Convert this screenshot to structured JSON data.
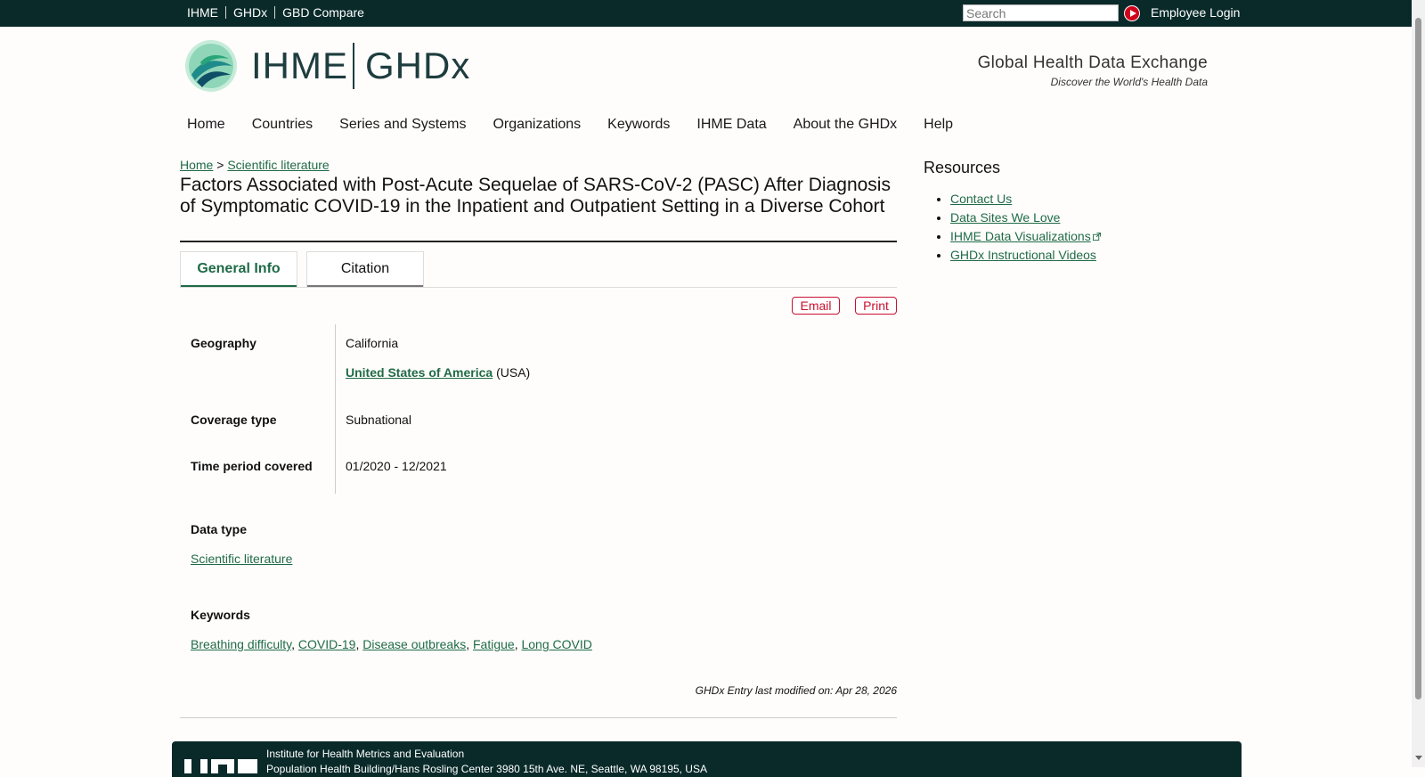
{
  "topbar": {
    "links": [
      "IHME",
      "GHDx",
      "GBD Compare"
    ],
    "search_placeholder": "Search",
    "employee_login": "Employee Login"
  },
  "header": {
    "logo_left": "IHME",
    "logo_right": "GHDx",
    "tagline": "Global Health Data Exchange",
    "subtagline": "Discover the World's Health Data"
  },
  "nav": [
    "Home",
    "Countries",
    "Series and Systems",
    "Organizations",
    "Keywords",
    "IHME Data",
    "About the GHDx",
    "Help"
  ],
  "breadcrumb": {
    "home": "Home",
    "sep": ">",
    "current": "Scientific literature"
  },
  "page": {
    "title": "Factors Associated with Post-Acute Sequelae of SARS-CoV-2 (PASC) After Diagnosis of Symptomatic COVID-19 in the Inpatient and Outpatient Setting in a Diverse Cohort"
  },
  "tabs": [
    "General Info",
    "Citation"
  ],
  "actions": {
    "email": "Email",
    "print": "Print"
  },
  "fields": {
    "geography_label": "Geography",
    "geography_region": "California",
    "geography_country": "United States of America",
    "geography_code": "(USA)",
    "coverage_label": "Coverage type",
    "coverage_value": "Subnational",
    "time_label": "Time period covered",
    "time_value": "01/2020 - 12/2021"
  },
  "data_type": {
    "label": "Data type",
    "value": "Scientific literature"
  },
  "keywords": {
    "label": "Keywords",
    "items": [
      "Breathing difficulty",
      "COVID-19",
      "Disease outbreaks",
      "Fatigue",
      "Long COVID"
    ]
  },
  "modified": "GHDx Entry last modified on: Apr 28, 2026",
  "sidebar": {
    "title": "Resources",
    "items": [
      "Contact Us",
      "Data Sites We Love",
      "IHME Data Visualizations",
      "GHDx Instructional Videos"
    ]
  },
  "footer": {
    "org": "Institute for Health Metrics and Evaluation",
    "address": "Population Health Building/Hans Rosling Center 3980 15th Ave. NE, Seattle, WA 98195, USA"
  },
  "colors": {
    "dark_teal": "#0a2a2a",
    "link_green": "#1f6b46",
    "accent_red": "#c8102e"
  }
}
